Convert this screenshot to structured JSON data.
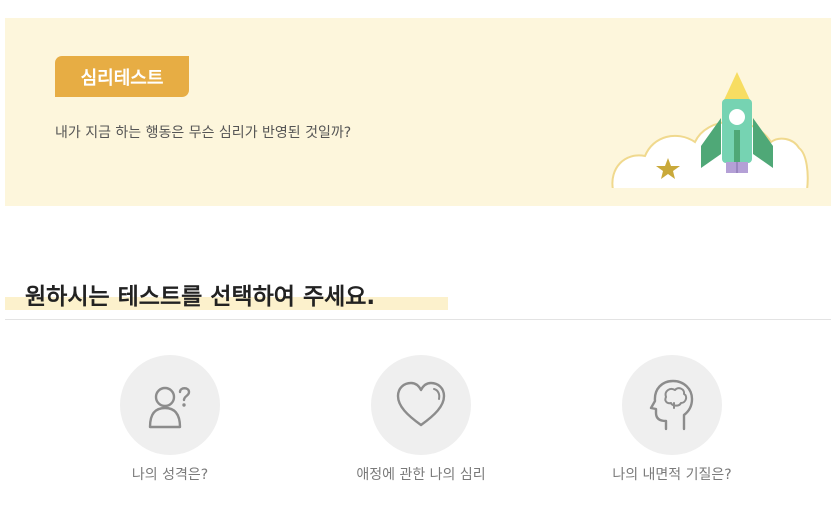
{
  "banner": {
    "badge": "심리테스트",
    "subtitle": "내가 지금 하는 행동은 무슨 심리가 반영된 것일까?",
    "illustration_icon": "rocket-icon",
    "colors": {
      "background": "#fdf6dc",
      "badge": "#e7ad44"
    }
  },
  "section": {
    "title": "원하시는 테스트를 선택하여 주세요."
  },
  "tests": [
    {
      "label": "나의 성격은?",
      "icon": "person-question-icon"
    },
    {
      "label": "애정에 관한 나의 심리",
      "icon": "heart-icon"
    },
    {
      "label": "나의 내면적 기질은?",
      "icon": "head-brain-icon"
    }
  ]
}
